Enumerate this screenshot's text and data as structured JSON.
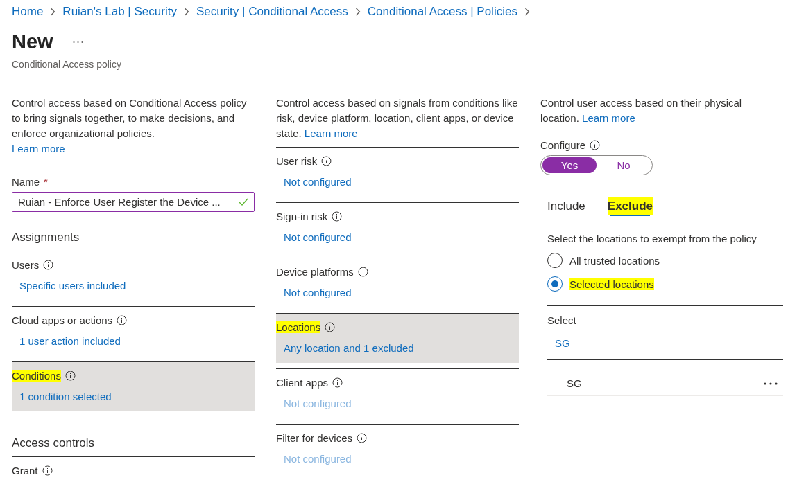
{
  "breadcrumbs": [
    {
      "label": "Home"
    },
    {
      "label": "Ruian's Lab | Security"
    },
    {
      "label": "Security | Conditional Access"
    },
    {
      "label": "Conditional Access | Policies"
    }
  ],
  "header": {
    "title": "New",
    "subtitle": "Conditional Access policy"
  },
  "left": {
    "description": "Control access based on Conditional Access policy to bring signals together, to make decisions, and enforce organizational policies.",
    "learn_more": "Learn more",
    "name_field": {
      "label": "Name",
      "required_mark": "*",
      "value": "Ruian - Enforce User Register the Device ...",
      "valid": true
    },
    "sections": [
      {
        "heading": "Assignments",
        "items": [
          {
            "label": "Users",
            "value": "Specific users included",
            "selected": false,
            "highlighted": false
          },
          {
            "label": "Cloud apps or actions",
            "value": "1 user action included",
            "selected": false,
            "highlighted": false
          },
          {
            "label": "Conditions",
            "value": "1 condition selected",
            "selected": true,
            "highlighted": true
          }
        ]
      },
      {
        "heading": "Access controls",
        "items": [
          {
            "label": "Grant",
            "selected": false,
            "highlighted": false
          }
        ]
      }
    ]
  },
  "middle": {
    "description": "Control access based on signals from conditions like risk, device platform, location, client apps, or device state.",
    "learn_more": "Learn more",
    "conditions": [
      {
        "label": "User risk",
        "value": "Not configured",
        "selected": false,
        "highlighted": false,
        "disabled": false
      },
      {
        "label": "Sign-in risk",
        "value": "Not configured",
        "selected": false,
        "highlighted": false,
        "disabled": false
      },
      {
        "label": "Device platforms",
        "value": "Not configured",
        "selected": false,
        "highlighted": false,
        "disabled": false
      },
      {
        "label": "Locations",
        "value": "Any location and 1 excluded",
        "selected": true,
        "highlighted": true,
        "disabled": false
      },
      {
        "label": "Client apps",
        "value": "Not configured",
        "selected": false,
        "highlighted": false,
        "disabled": true
      },
      {
        "label": "Filter for devices",
        "value": "Not configured",
        "selected": false,
        "highlighted": false,
        "disabled": true
      }
    ]
  },
  "right": {
    "description": "Control user access based on their physical location.",
    "learn_more": "Learn more",
    "configure": {
      "label": "Configure",
      "options": [
        {
          "label": "Yes",
          "selected": true
        },
        {
          "label": "No",
          "selected": false
        }
      ]
    },
    "tabs": [
      {
        "label": "Include",
        "selected": false,
        "highlighted": false
      },
      {
        "label": "Exclude",
        "selected": true,
        "highlighted": true
      }
    ],
    "prompt": "Select the locations to exempt from the policy",
    "radios": [
      {
        "label": "All trusted locations",
        "selected": false,
        "highlighted": false
      },
      {
        "label": "Selected locations",
        "selected": true,
        "highlighted": true
      }
    ],
    "select": {
      "label": "Select",
      "value": "SG"
    },
    "selected_items": [
      {
        "label": "SG"
      }
    ]
  }
}
